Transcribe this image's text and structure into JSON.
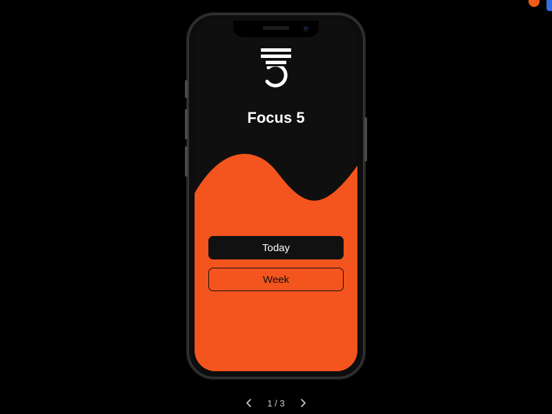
{
  "colors": {
    "accent": "#f4541d",
    "dark": "#0f0f0f",
    "text_light": "#ffffff",
    "text_dark": "#111111"
  },
  "app": {
    "title": "Focus 5",
    "logo_name": "focus5-logo",
    "buttons": {
      "primary": "Today",
      "secondary": "Week"
    }
  },
  "pager": {
    "current": 1,
    "total": 3,
    "label": "1 / 3"
  }
}
